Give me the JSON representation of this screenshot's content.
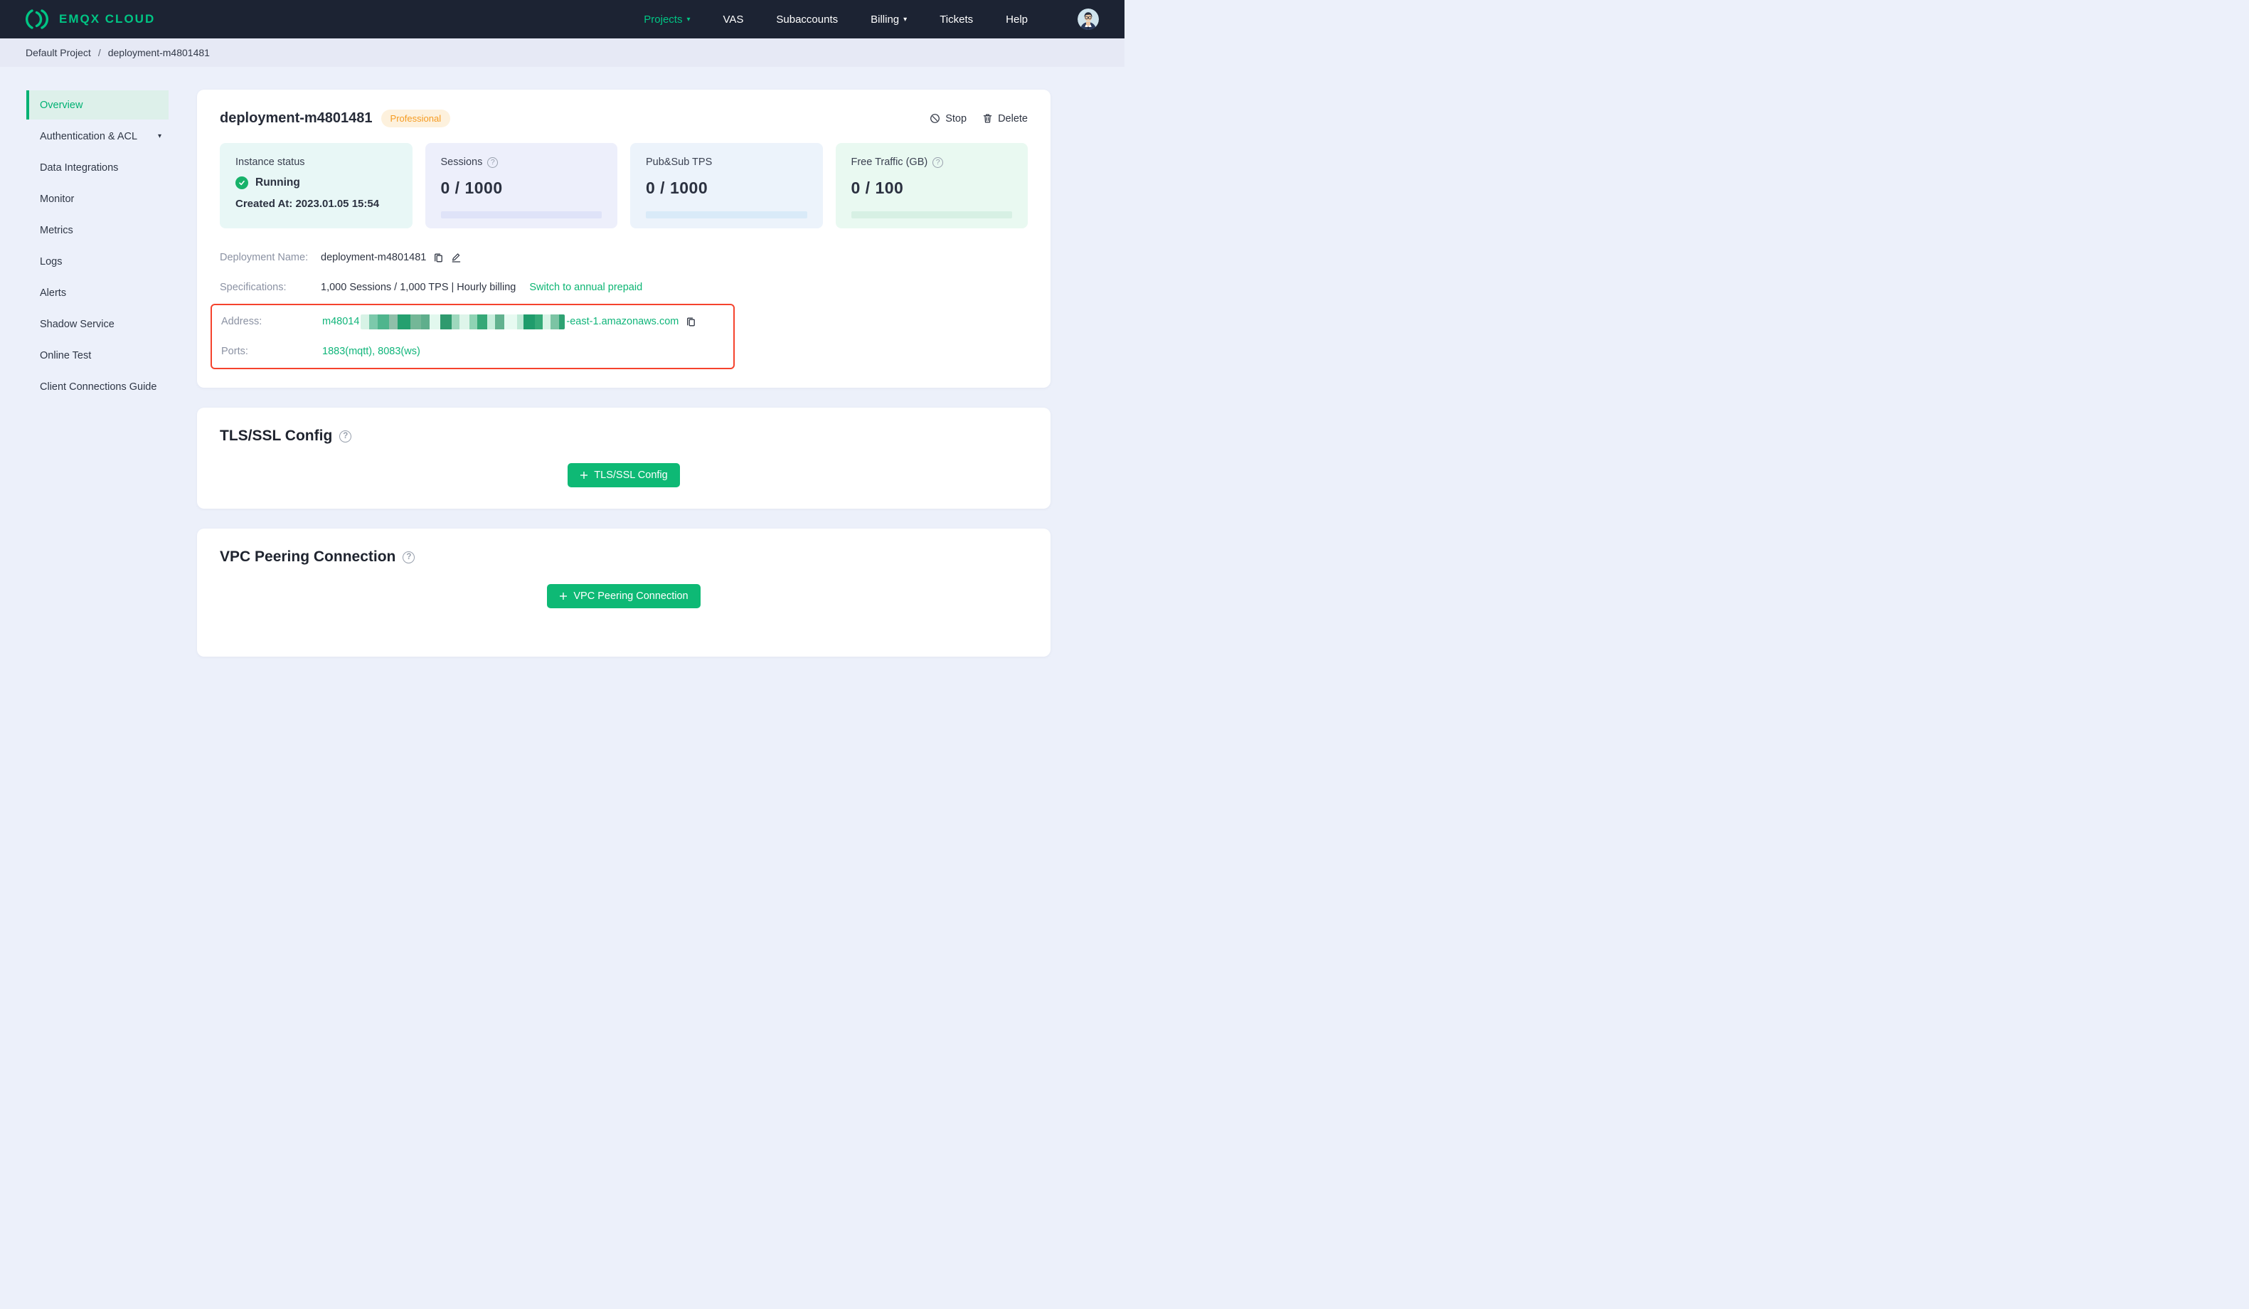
{
  "nav": {
    "brand": "EMQX CLOUD",
    "items": [
      {
        "label": "Projects",
        "active": true,
        "caret": true
      },
      {
        "label": "VAS"
      },
      {
        "label": "Subaccounts"
      },
      {
        "label": "Billing",
        "caret": true
      },
      {
        "label": "Tickets"
      },
      {
        "label": "Help"
      }
    ]
  },
  "breadcrumb": {
    "project": "Default Project",
    "separator": "/",
    "page": "deployment-m4801481"
  },
  "sidebar": {
    "items": [
      {
        "label": "Overview",
        "active": true
      },
      {
        "label": "Authentication & ACL",
        "caret": true
      },
      {
        "label": "Data Integrations"
      },
      {
        "label": "Monitor"
      },
      {
        "label": "Metrics"
      },
      {
        "label": "Logs"
      },
      {
        "label": "Alerts"
      },
      {
        "label": "Shadow Service"
      },
      {
        "label": "Online Test"
      },
      {
        "label": "Client Connections Guide"
      }
    ]
  },
  "overview": {
    "title": "deployment-m4801481",
    "badge": "Professional",
    "actions": {
      "stop": "Stop",
      "delete": "Delete"
    },
    "stats": [
      {
        "label": "Instance status",
        "status": "Running",
        "created": "Created At: 2023.01.05 15:54"
      },
      {
        "label": "Sessions",
        "help": true,
        "value": "0 / 1000"
      },
      {
        "label": "Pub&Sub TPS",
        "value": "0 / 1000"
      },
      {
        "label": "Free Traffic (GB)",
        "help": true,
        "value": "0 / 100"
      }
    ],
    "info": {
      "deployment_name_label": "Deployment Name:",
      "deployment_name": "deployment-m4801481",
      "specifications_label": "Specifications:",
      "specifications": "1,000 Sessions / 1,000 TPS | Hourly billing",
      "switch_link": "Switch to annual prepaid",
      "address_label": "Address:",
      "address_prefix": "m48014",
      "address_redacted": true,
      "address_suffix": "-east-1.amazonaws.com",
      "ports_label": "Ports:",
      "ports": "1883(mqtt), 8083(ws)"
    }
  },
  "tls": {
    "title": "TLS/SSL Config",
    "button": "TLS/SSL Config"
  },
  "vpc": {
    "title": "VPC Peering Connection",
    "button": "VPC Peering Connection"
  },
  "colors": {
    "accent_green": "#00b173",
    "nav_dark": "#1c2333",
    "highlight_red": "#f5432d",
    "badge_bg": "#fdf1dd",
    "badge_text": "#f59b22"
  }
}
